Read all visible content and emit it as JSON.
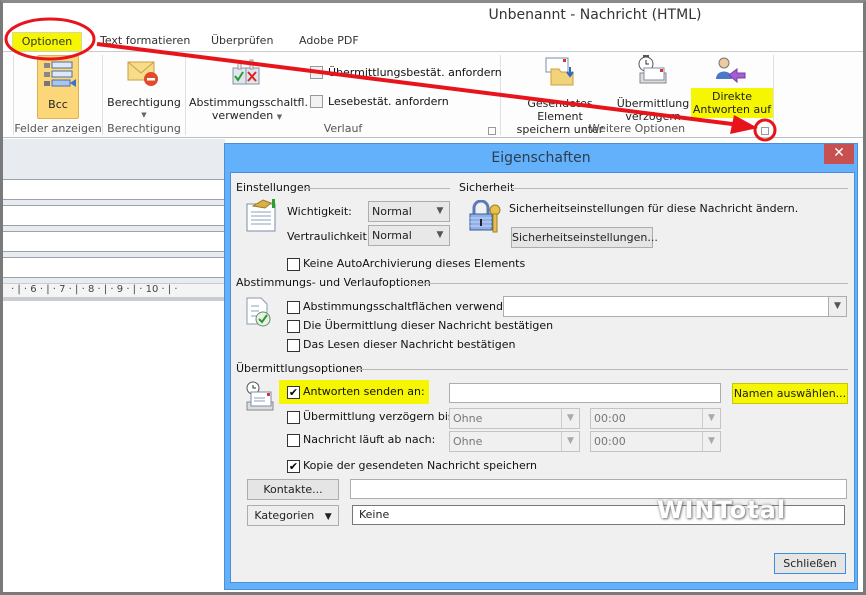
{
  "window": {
    "title": "Unbenannt - Nachricht (HTML)"
  },
  "tabs": [
    {
      "label": "Optionen",
      "active": true
    },
    {
      "label": "Text formatieren"
    },
    {
      "label": "Überprüfen"
    },
    {
      "label": "Adobe PDF"
    }
  ],
  "ribbon": {
    "felder": {
      "bcc": "Bcc",
      "group": "Felder anzeigen"
    },
    "berechtigung": {
      "button": "Berechtigung",
      "group": "Berechtigung"
    },
    "verlauf": {
      "abstimmung_line1": "Abstimmungsschaltfl.",
      "abstimmung_line2": "verwenden",
      "uebermittlung_check": "Übermittlungsbestät. anfordern",
      "lese_check": "Lesebestät. anfordern",
      "group": "Verlauf"
    },
    "weitere": {
      "gesendet_line1": "Gesendetes Element",
      "gesendet_line2": "speichern unter",
      "verzoegern_line1": "Übermittlung",
      "verzoegern_line2": "verzögern",
      "direkte_line1": "Direkte",
      "direkte_line2": "Antworten auf",
      "group": "Weitere Optionen"
    }
  },
  "ruler": {
    "marks": [
      "6",
      "7",
      "8",
      "9",
      "10"
    ]
  },
  "dialog": {
    "title": "Eigenschaften",
    "close": "✕",
    "einstellungen": {
      "heading": "Einstellungen",
      "wichtigkeit_label": "Wichtigkeit:",
      "wichtigkeit_value": "Normal",
      "vertraulichkeit_label": "Vertraulichkeit:",
      "vertraulichkeit_value": "Normal",
      "autoarchiv": "Keine AutoArchivierung dieses Elements"
    },
    "sicherheit": {
      "heading": "Sicherheit",
      "text": "Sicherheitseinstellungen für diese Nachricht ändern.",
      "button": "Sicherheitseinstellungen..."
    },
    "abstimmung": {
      "heading": "Abstimmungs- und Verlaufoptionen",
      "buttons_label": "Abstimmungsschaltflächen verwenden:",
      "buttons_value": "",
      "confirm_delivery": "Die Übermittlung dieser Nachricht bestätigen",
      "confirm_read": "Das Lesen dieser Nachricht bestätigen"
    },
    "uebermittlung": {
      "heading": "Übermittlungsoptionen",
      "reply_to_label": "Antworten senden an:",
      "reply_to_checked": true,
      "reply_to_value": "",
      "names_button": "Namen auswählen...",
      "delay_label": "Übermittlung verzögern bis:",
      "delay_date": "Ohne",
      "delay_time": "00:00",
      "expires_label": "Nachricht läuft ab nach:",
      "expires_date": "Ohne",
      "expires_time": "00:00",
      "save_copy_label": "Kopie der gesendeten Nachricht speichern",
      "save_copy_checked": true
    },
    "kontakte_button": "Kontakte...",
    "kontakte_value": "",
    "kategorien_button": "Kategorien",
    "kategorien_value": "Keine",
    "close_button": "Schließen"
  },
  "watermark": "WINTotal",
  "colors": {
    "highlight": "#f6f600",
    "annotation": "#e8141b",
    "dialog_frame": "#63b0fb",
    "close": "#c75050"
  }
}
